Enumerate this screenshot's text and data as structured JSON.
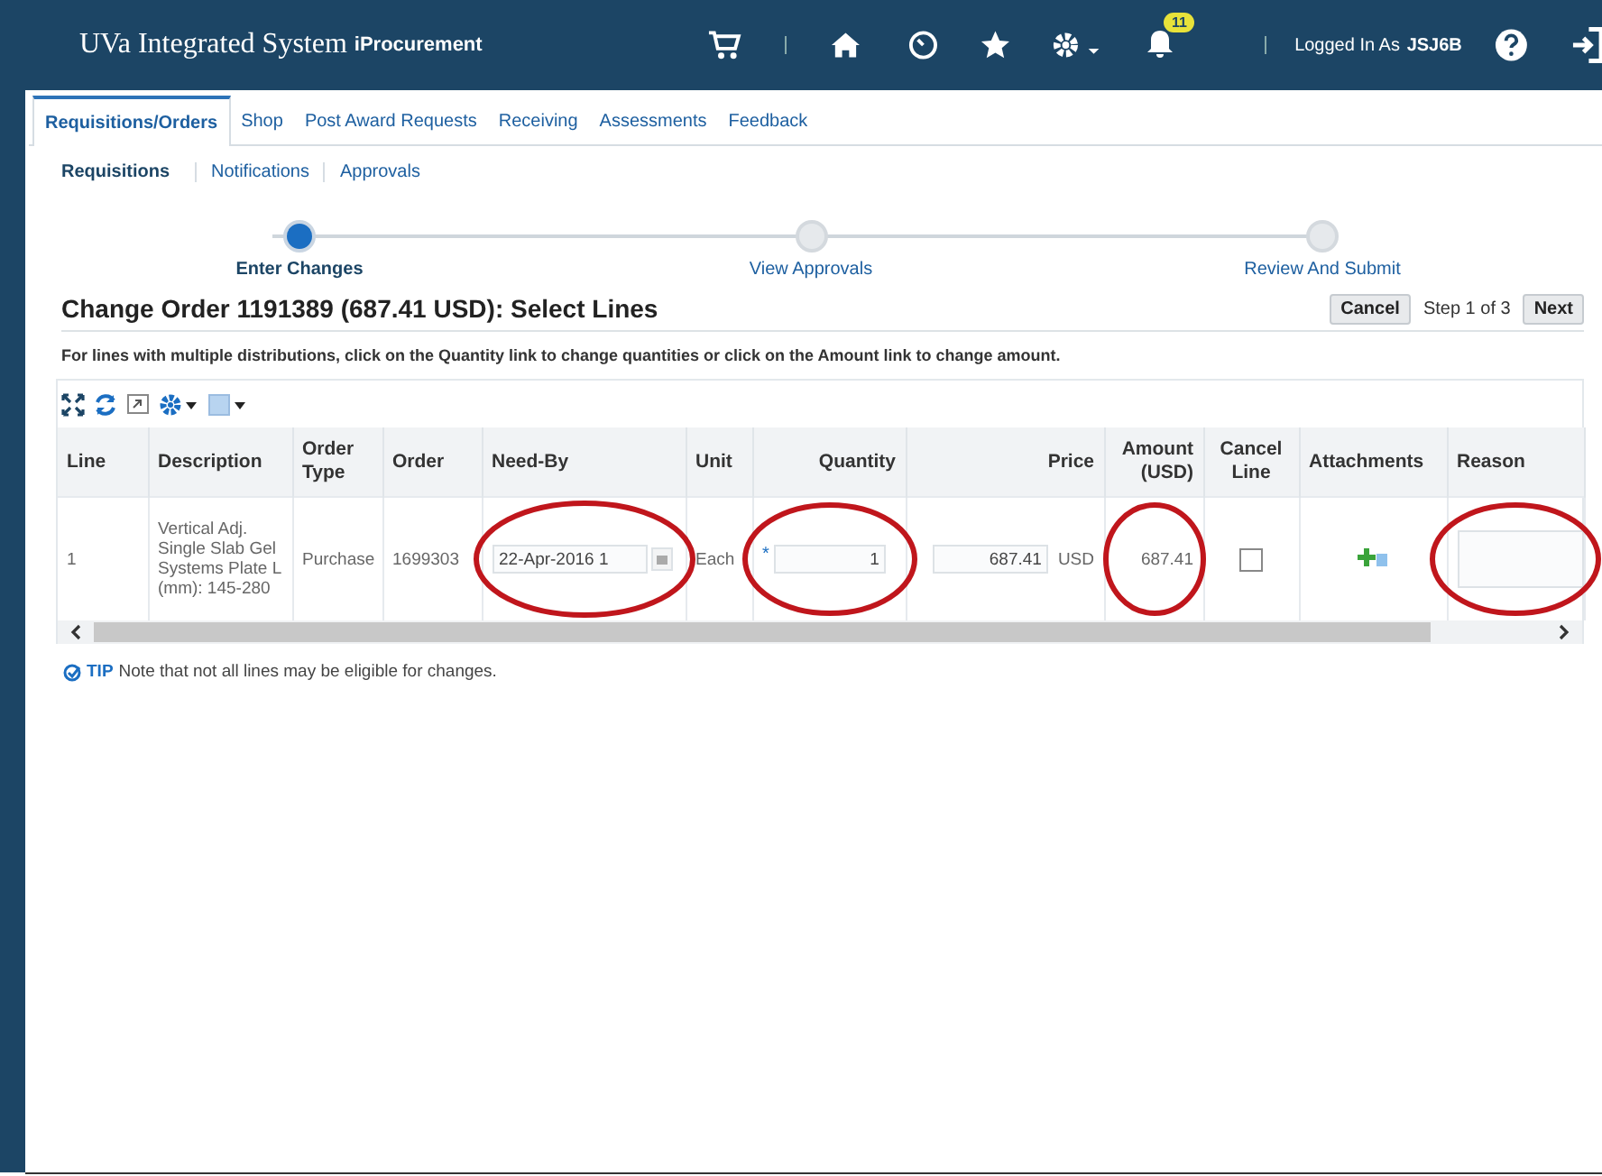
{
  "header": {
    "title": "UVa Integrated System",
    "subtitle": "iProcurement",
    "notification_count": "11",
    "user_label": "Logged In As",
    "user": "JSJ6B"
  },
  "tabs": [
    {
      "label": "Requisitions/Orders",
      "selected": true
    },
    {
      "label": "Shop",
      "selected": false
    },
    {
      "label": "Post Award Requests",
      "selected": false
    },
    {
      "label": "Receiving",
      "selected": false
    },
    {
      "label": "Assessments",
      "selected": false
    },
    {
      "label": "Feedback",
      "selected": false
    }
  ],
  "subtabs": [
    {
      "label": "Requisitions",
      "selected": true
    },
    {
      "label": "Notifications",
      "selected": false
    },
    {
      "label": "Approvals",
      "selected": false
    }
  ],
  "train": [
    {
      "label": "Enter Changes",
      "selected": true
    },
    {
      "label": "View Approvals",
      "selected": false
    },
    {
      "label": "Review And Submit",
      "selected": false
    }
  ],
  "page_title": "Change Order 1191389 (687.41 USD): Select Lines",
  "actions": {
    "cancel": "Cancel",
    "step": "Step 1 of 3",
    "next": "Next"
  },
  "instruction": "For lines with multiple distributions, click on the Quantity link to change quantities or click on the Amount link to change amount.",
  "table": {
    "columns": [
      "Line",
      "Description",
      "Order Type",
      "Order",
      "Need-By",
      "Unit",
      "Quantity",
      "Price",
      "Amount (USD)",
      "Cancel Line",
      "Attachments",
      "Reason"
    ],
    "rows": [
      {
        "line": "1",
        "description": "Vertical Adj. Single Slab Gel Systems Plate L (mm): 145-280",
        "order_type": "Purchase",
        "order": "1699303",
        "need_by": "22-Apr-2016 1",
        "unit": "Each",
        "required_mark": "*",
        "quantity": "1",
        "price": "687.41",
        "currency": "USD",
        "amount": "687.41",
        "cancel_line": false
      }
    ]
  },
  "tip": {
    "label": "TIP",
    "text": "Note that not all lines may be eligible for changes."
  }
}
